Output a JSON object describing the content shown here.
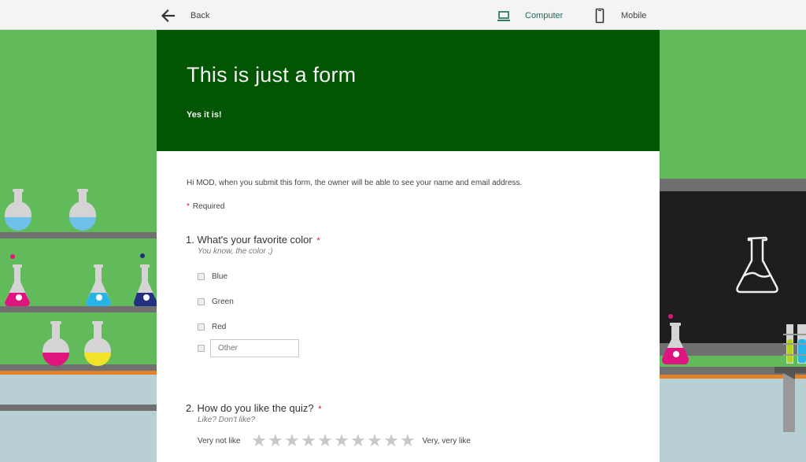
{
  "topbar": {
    "back_label": "Back",
    "back_icon": "arrow-left-icon",
    "views": [
      {
        "label": "Computer",
        "icon": "laptop-icon",
        "active": true
      },
      {
        "label": "Mobile",
        "icon": "phone-icon",
        "active": false
      }
    ]
  },
  "colors": {
    "hero": "#025502",
    "active_view": "#1e6b5c",
    "required": "#e81123",
    "scene_green": "#62bb5a",
    "scene_floor": "#b8d0d4"
  },
  "form": {
    "title": "This is just a form",
    "subtitle": "Yes it is!",
    "notice": "Hi MOD, when you submit this form, the owner will be able to see your name and email address.",
    "required_marker": "*",
    "required_label": "Required",
    "questions": [
      {
        "number": "1.",
        "title": "What's your favorite color",
        "required": "*",
        "description": "You know, the color ;)",
        "type": "checkbox",
        "options": [
          "Blue",
          "Green",
          "Red"
        ],
        "other_placeholder": "Other"
      },
      {
        "number": "2.",
        "title": "How do you like the quiz?",
        "required": "*",
        "description": "Like? Don't like?",
        "type": "rating",
        "rating_min_label": "Very not like",
        "rating_max_label": "Very, very like",
        "rating_scale": 10,
        "rating_value": 0
      }
    ]
  }
}
